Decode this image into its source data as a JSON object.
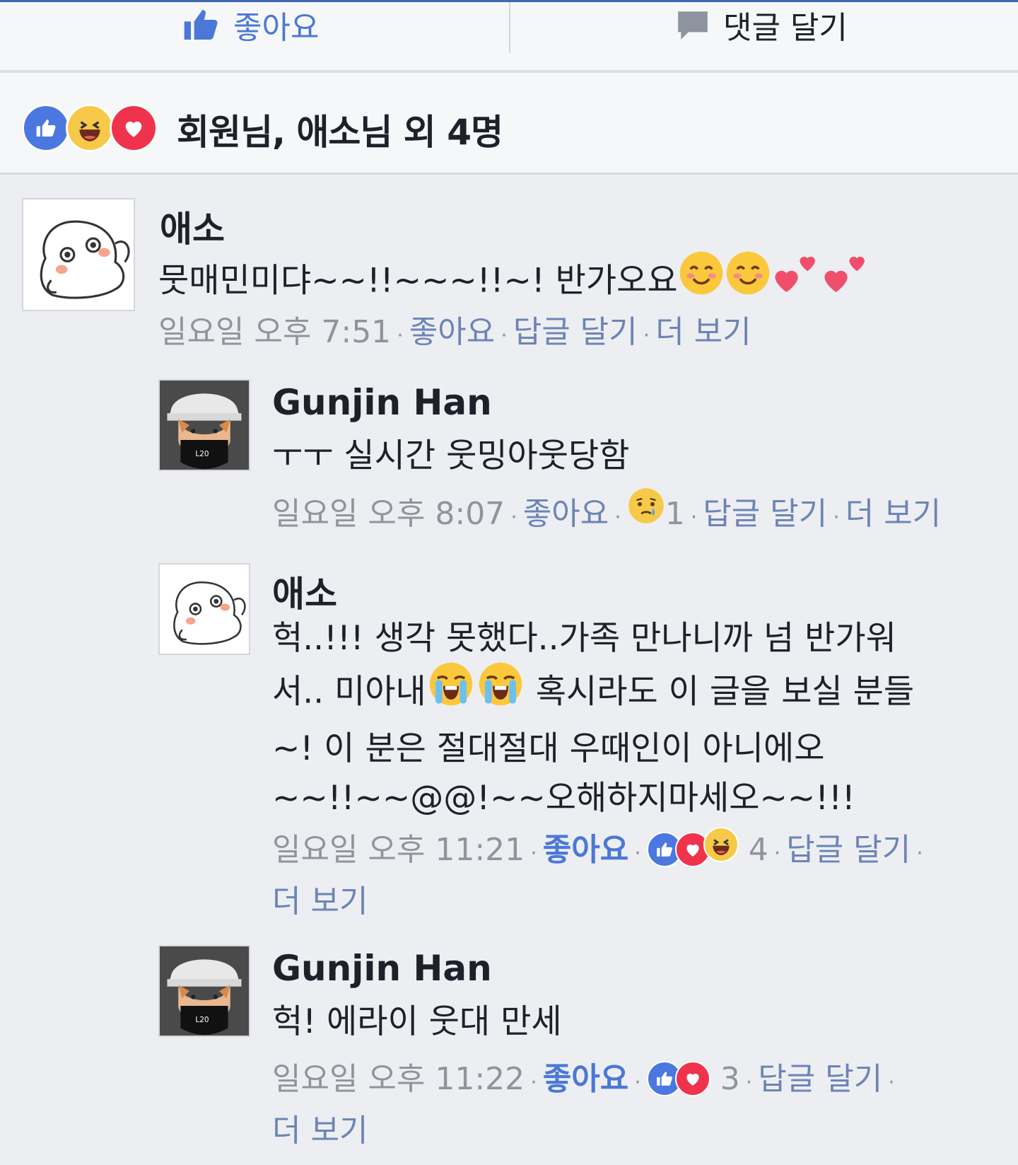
{
  "actions": {
    "like_label": "좋아요",
    "comment_label": "댓글 달기"
  },
  "summary": {
    "text": "회원님, 애소님 외 4명",
    "icons": [
      "like-icon",
      "haha-icon",
      "love-icon"
    ]
  },
  "comments": [
    {
      "author": "애소",
      "text": "뭇매민미댜~~!!~~~!!~! 반가오요",
      "emoji": [
        "blush-emoji",
        "blush-emoji",
        "two-hearts-emoji",
        "two-hearts-emoji"
      ],
      "time": "일요일 오후 7:51",
      "like_label": "좋아요",
      "reply_label": "답글 달기",
      "more_label": "더 보기"
    },
    {
      "author": "Gunjin Han",
      "text": "ㅜㅜ 실시간 웃밍아웃당함",
      "time": "일요일 오후 8:07",
      "like_label": "좋아요",
      "reaction_count": "1",
      "reactions": [
        "sad-icon"
      ],
      "reply_label": "답글 달기",
      "more_label": "더 보기"
    },
    {
      "author": "애소",
      "text_lines": [
        "헉..!!! 생각 못했다..가족 만나니까 넘 반가워",
        "서.. 미아내",
        "혹시라도 이 글을 보실 분들",
        "~! 이 분은 절대절대 우때인이 아니에오",
        "~~!!~~@@!~~오해하지마세오~~!!!"
      ],
      "emoji": [
        "loudly-crying-emoji",
        "loudly-crying-emoji"
      ],
      "time": "일요일 오후 11:21",
      "like_label": "좋아요",
      "reaction_count": "4",
      "reactions": [
        "like-icon",
        "love-icon",
        "haha-icon"
      ],
      "reply_label": "답글 달기",
      "more_label": "더 보기"
    },
    {
      "author": "Gunjin Han",
      "text": "헉! 에라이 웃대 만세",
      "time": "일요일 오후 11:22",
      "like_label": "좋아요",
      "reaction_count": "3",
      "reactions": [
        "like-icon",
        "love-icon"
      ],
      "reply_label": "답글 달기",
      "more_label": "더 보기"
    }
  ],
  "colors": {
    "accent": "#4267b2",
    "like_blue": "#4b78e0",
    "love_red": "#f0334d",
    "haha_yellow": "#f7c948",
    "meta_gray": "#90949c",
    "link_blue": "#6d84b4"
  }
}
